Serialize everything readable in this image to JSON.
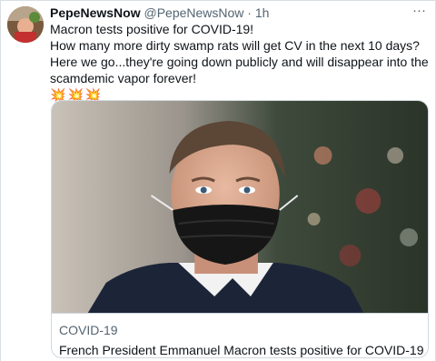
{
  "header": {
    "name": "PepeNewsNow",
    "handle": "@PepeNewsNow",
    "separator": "·",
    "time": "1h",
    "more_icon": "more-horizontal-icon"
  },
  "tweet": {
    "lines": [
      "Macron tests positive for COVID-19!",
      "How many more dirty swamp rats will get CV in the next 10 days?",
      "Here we go...they're going down publicly and will disappear into the",
      "scamdemic vapor forever!"
    ],
    "emojis": [
      "💥",
      "💥",
      "💥"
    ]
  },
  "card": {
    "domain": "COVID-19",
    "title": "French President Emmanuel Macron tests positive for COVID-19"
  },
  "colors": {
    "text": "#0f1419",
    "secondary": "#536471",
    "border": "#cfd9de"
  }
}
